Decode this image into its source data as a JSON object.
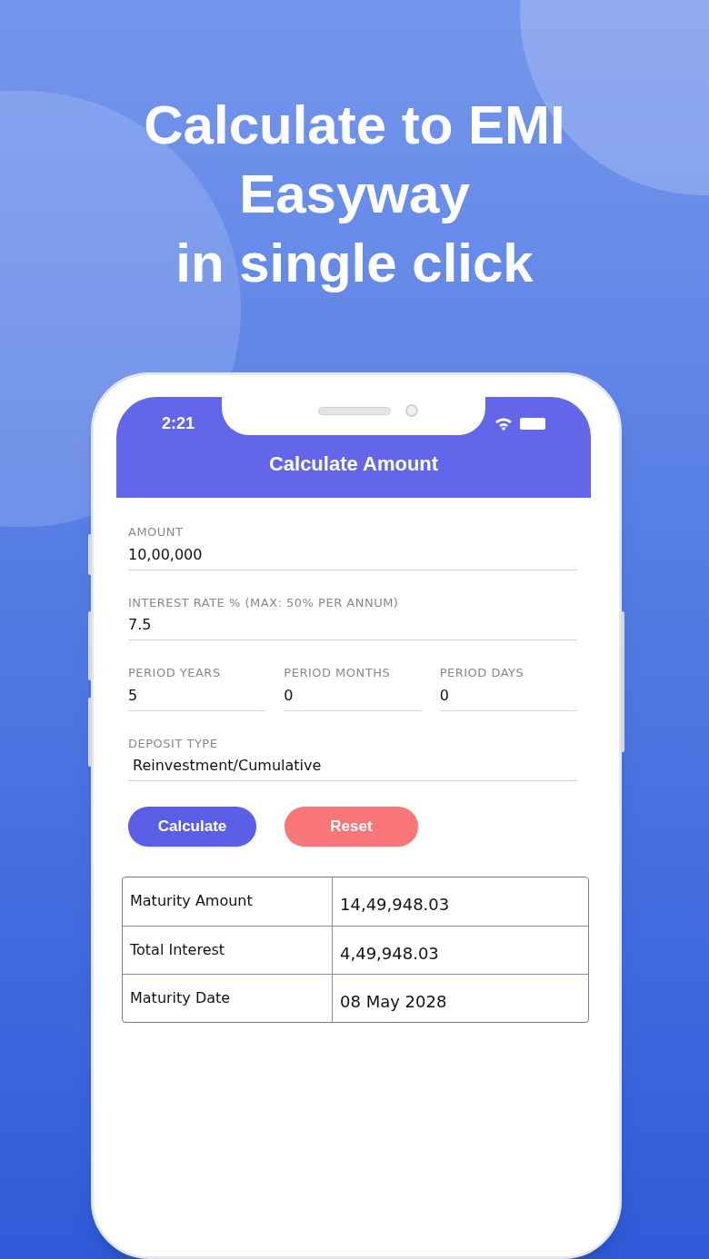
{
  "headline": [
    "Calculate to EMI",
    "Easyway",
    "in single click"
  ],
  "status_bar": {
    "time": "2:21"
  },
  "app_bar": {
    "title": "Calculate Amount"
  },
  "form": {
    "rows": [
      {
        "fields": [
          {
            "label": "AMOUNT",
            "value": "10,00,000"
          }
        ]
      },
      {
        "fields": [
          {
            "label": "INTEREST RATE % (MAX: 50% PER ANNUM)",
            "value": "7.5"
          }
        ]
      },
      {
        "fields": [
          {
            "label": "PERIOD YEARS",
            "value": "5"
          },
          {
            "label": "PERIOD MONTHS",
            "value": "0"
          },
          {
            "label": "PERIOD DAYS",
            "value": "0"
          }
        ]
      },
      {
        "fields": [
          {
            "label": "DEPOSIT TYPE",
            "value": "Reinvestment/Cumulative",
            "kind": "dropdown"
          }
        ]
      }
    ]
  },
  "buttons": [
    {
      "label": "Calculate",
      "kind": "primary"
    },
    {
      "label": "Reset",
      "kind": "danger"
    }
  ],
  "results": [
    {
      "label": "Maturity Amount",
      "value": "14,49,948.03"
    },
    {
      "label": "Total Interest",
      "value": "4,49,948.03"
    },
    {
      "label": "Maturity Date",
      "value": "08 May 2028"
    }
  ]
}
